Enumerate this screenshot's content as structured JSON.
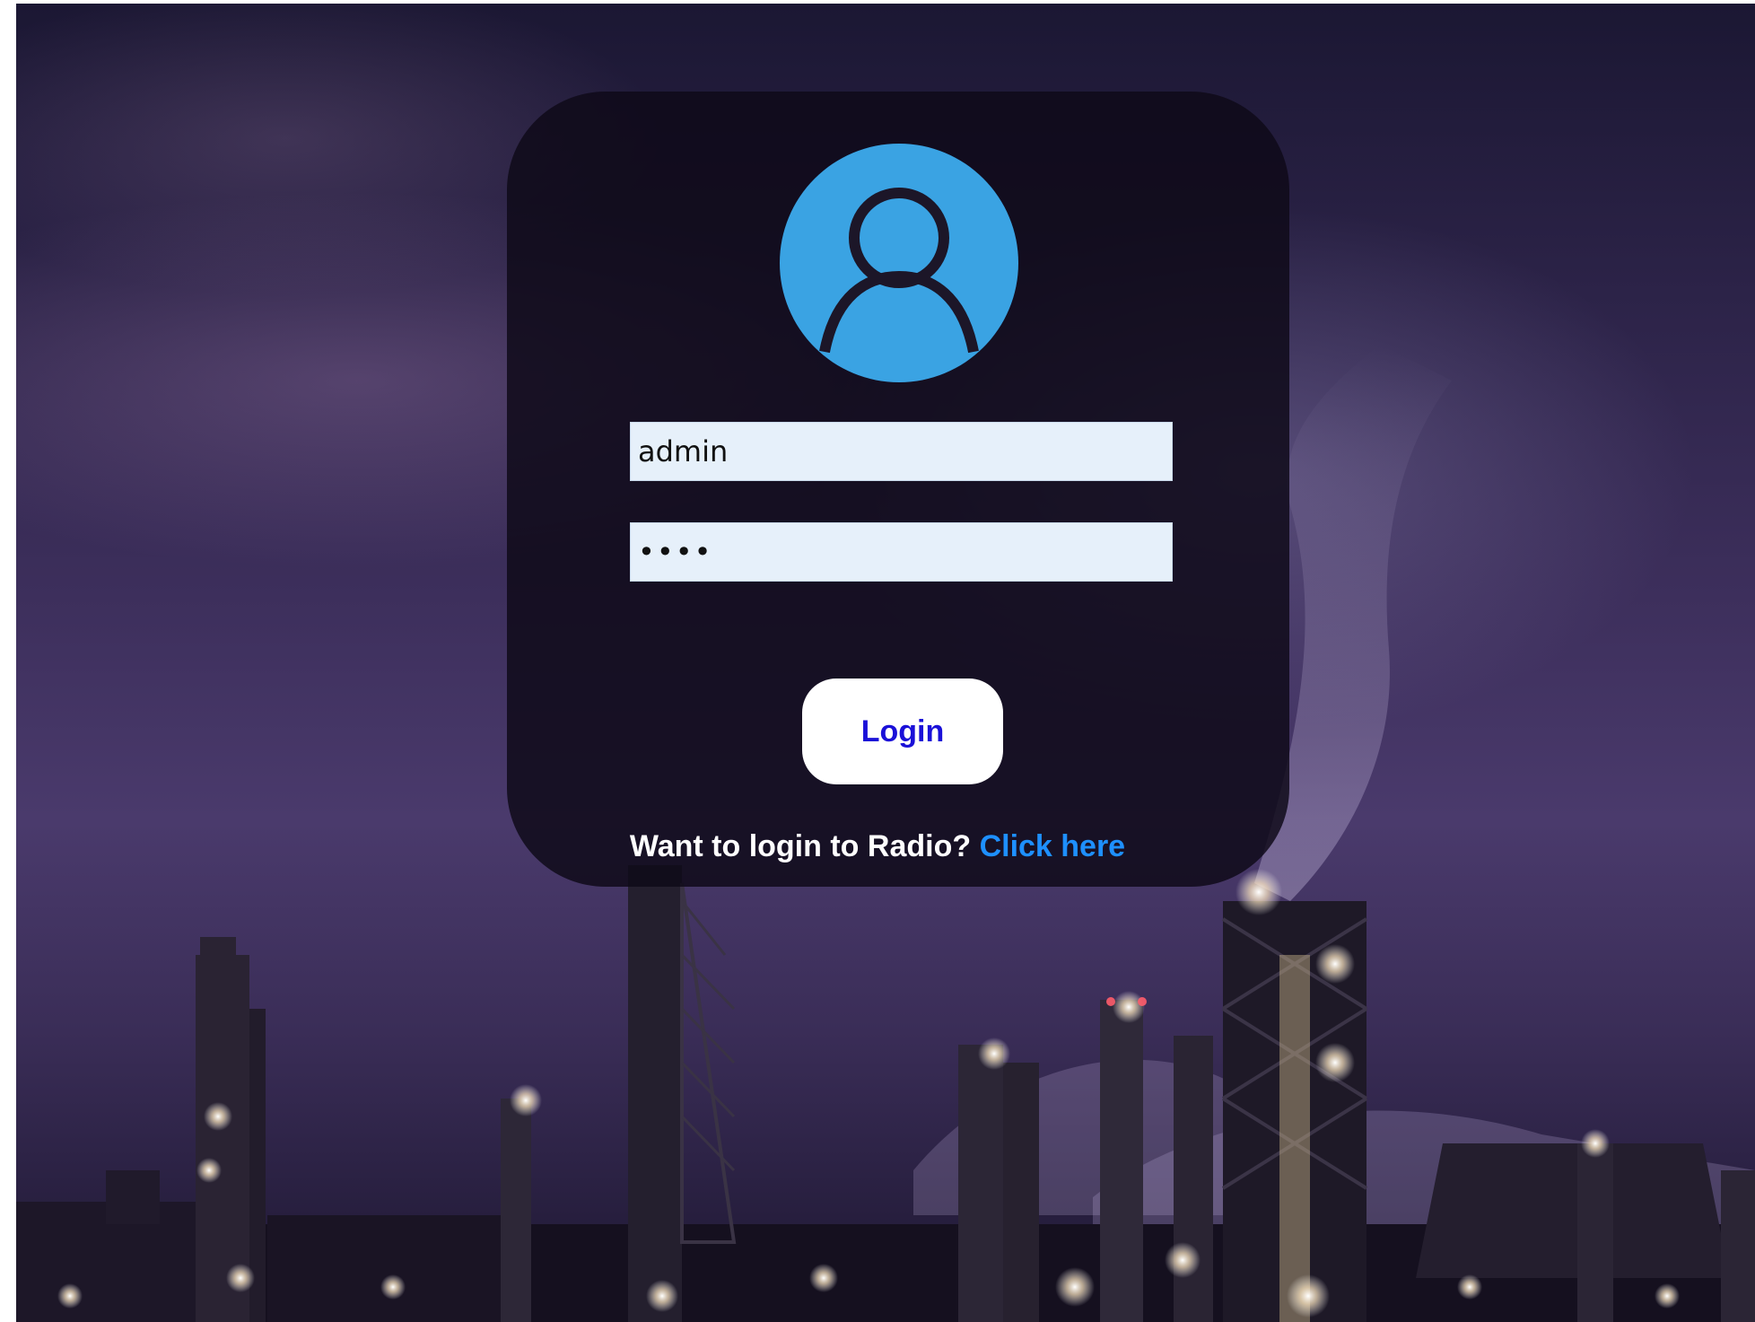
{
  "login_form": {
    "username_value": "admin",
    "password_value": "pass",
    "login_label": "Login"
  },
  "radio": {
    "prompt": "Want to login to Radio?",
    "link_label": "Click here"
  },
  "colors": {
    "avatar_circle": "#3aa3e3",
    "login_text": "#1a10d8",
    "link_text": "#1e90ff",
    "input_background": "#e6f0fa"
  },
  "icons": {
    "avatar": "user-avatar-icon"
  },
  "background": {
    "description_icon": "industrial-plant-night-photo"
  }
}
